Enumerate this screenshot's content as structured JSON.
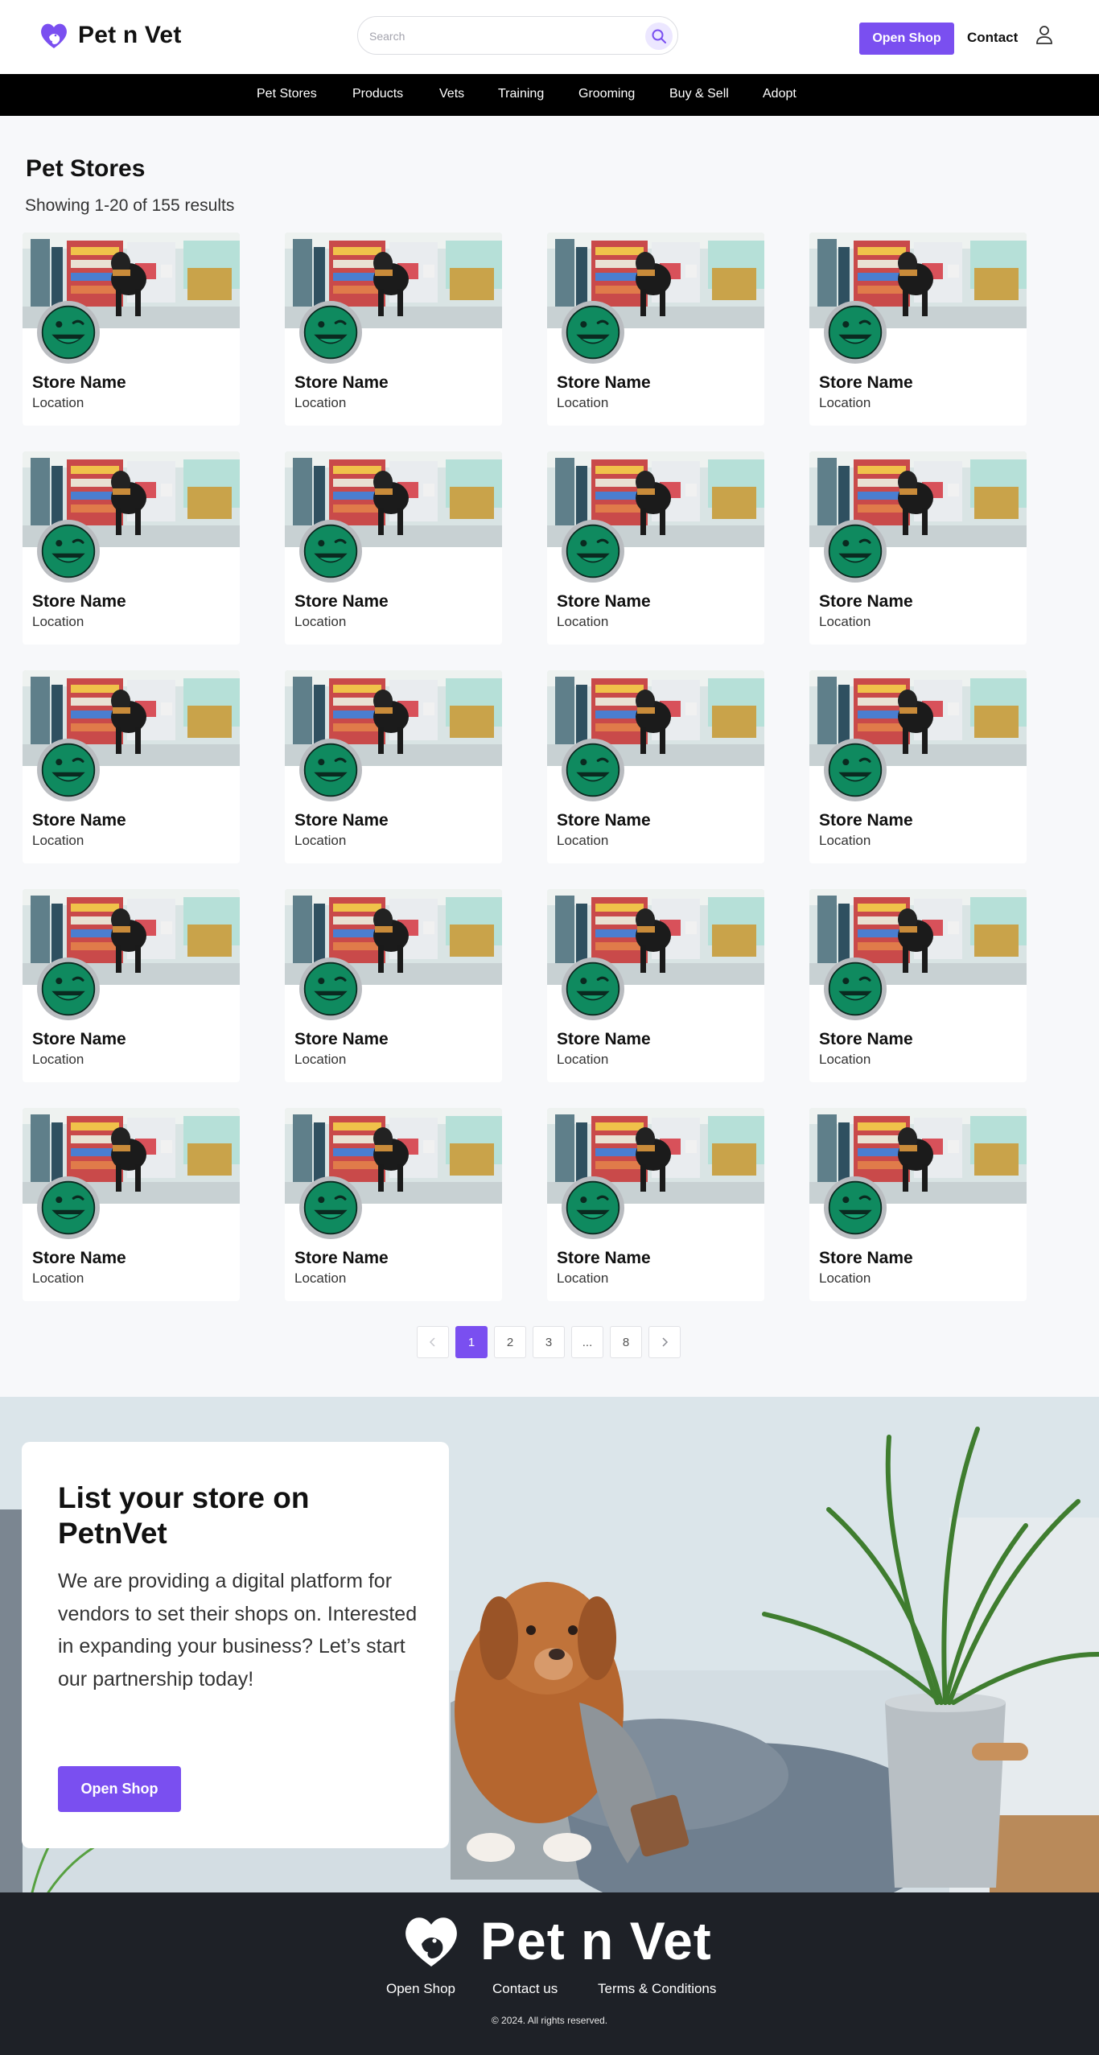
{
  "header": {
    "logo_text": "Pet n Vet",
    "search_placeholder": "Search",
    "open_shop_label": "Open Shop",
    "contact_label": "Contact"
  },
  "nav": {
    "items": [
      "Pet Stores",
      "Products",
      "Vets",
      "Training",
      "Grooming",
      "Buy & Sell",
      "Adopt"
    ]
  },
  "main": {
    "title": "Pet Stores",
    "results_text": "Showing 1-20 of 155 results"
  },
  "stores": [
    {
      "name": "Store Name",
      "location": "Location"
    },
    {
      "name": "Store Name",
      "location": "Location"
    },
    {
      "name": "Store Name",
      "location": "Location"
    },
    {
      "name": "Store Name",
      "location": "Location"
    },
    {
      "name": "Store Name",
      "location": "Location"
    },
    {
      "name": "Store Name",
      "location": "Location"
    },
    {
      "name": "Store Name",
      "location": "Location"
    },
    {
      "name": "Store Name",
      "location": "Location"
    },
    {
      "name": "Store Name",
      "location": "Location"
    },
    {
      "name": "Store Name",
      "location": "Location"
    },
    {
      "name": "Store Name",
      "location": "Location"
    },
    {
      "name": "Store Name",
      "location": "Location"
    },
    {
      "name": "Store Name",
      "location": "Location"
    },
    {
      "name": "Store Name",
      "location": "Location"
    },
    {
      "name": "Store Name",
      "location": "Location"
    },
    {
      "name": "Store Name",
      "location": "Location"
    },
    {
      "name": "Store Name",
      "location": "Location"
    },
    {
      "name": "Store Name",
      "location": "Location"
    },
    {
      "name": "Store Name",
      "location": "Location"
    },
    {
      "name": "Store Name",
      "location": "Location"
    }
  ],
  "pagination": {
    "prev_icon": "chevron-left-icon",
    "pages": [
      "1",
      "2",
      "3",
      "...",
      "8"
    ],
    "current": "1",
    "next_icon": "chevron-right-icon"
  },
  "banner": {
    "title": "List your store on PetnVet",
    "description": "We are providing a digital platform for vendors to set their shops on. Interested in expanding your business? Let’s start our partnership today!",
    "button_label": "Open Shop"
  },
  "footer": {
    "logo_text": "Pet n Vet",
    "links": [
      "Open Shop",
      "Contact us",
      "Terms & Conditions"
    ],
    "copyright": "© 2024. All rights reserved."
  },
  "colors": {
    "accent": "#7a4ff0",
    "nav_bg": "#000000",
    "footer_bg": "#1e2127",
    "avatar_green": "#0f8a5f"
  }
}
